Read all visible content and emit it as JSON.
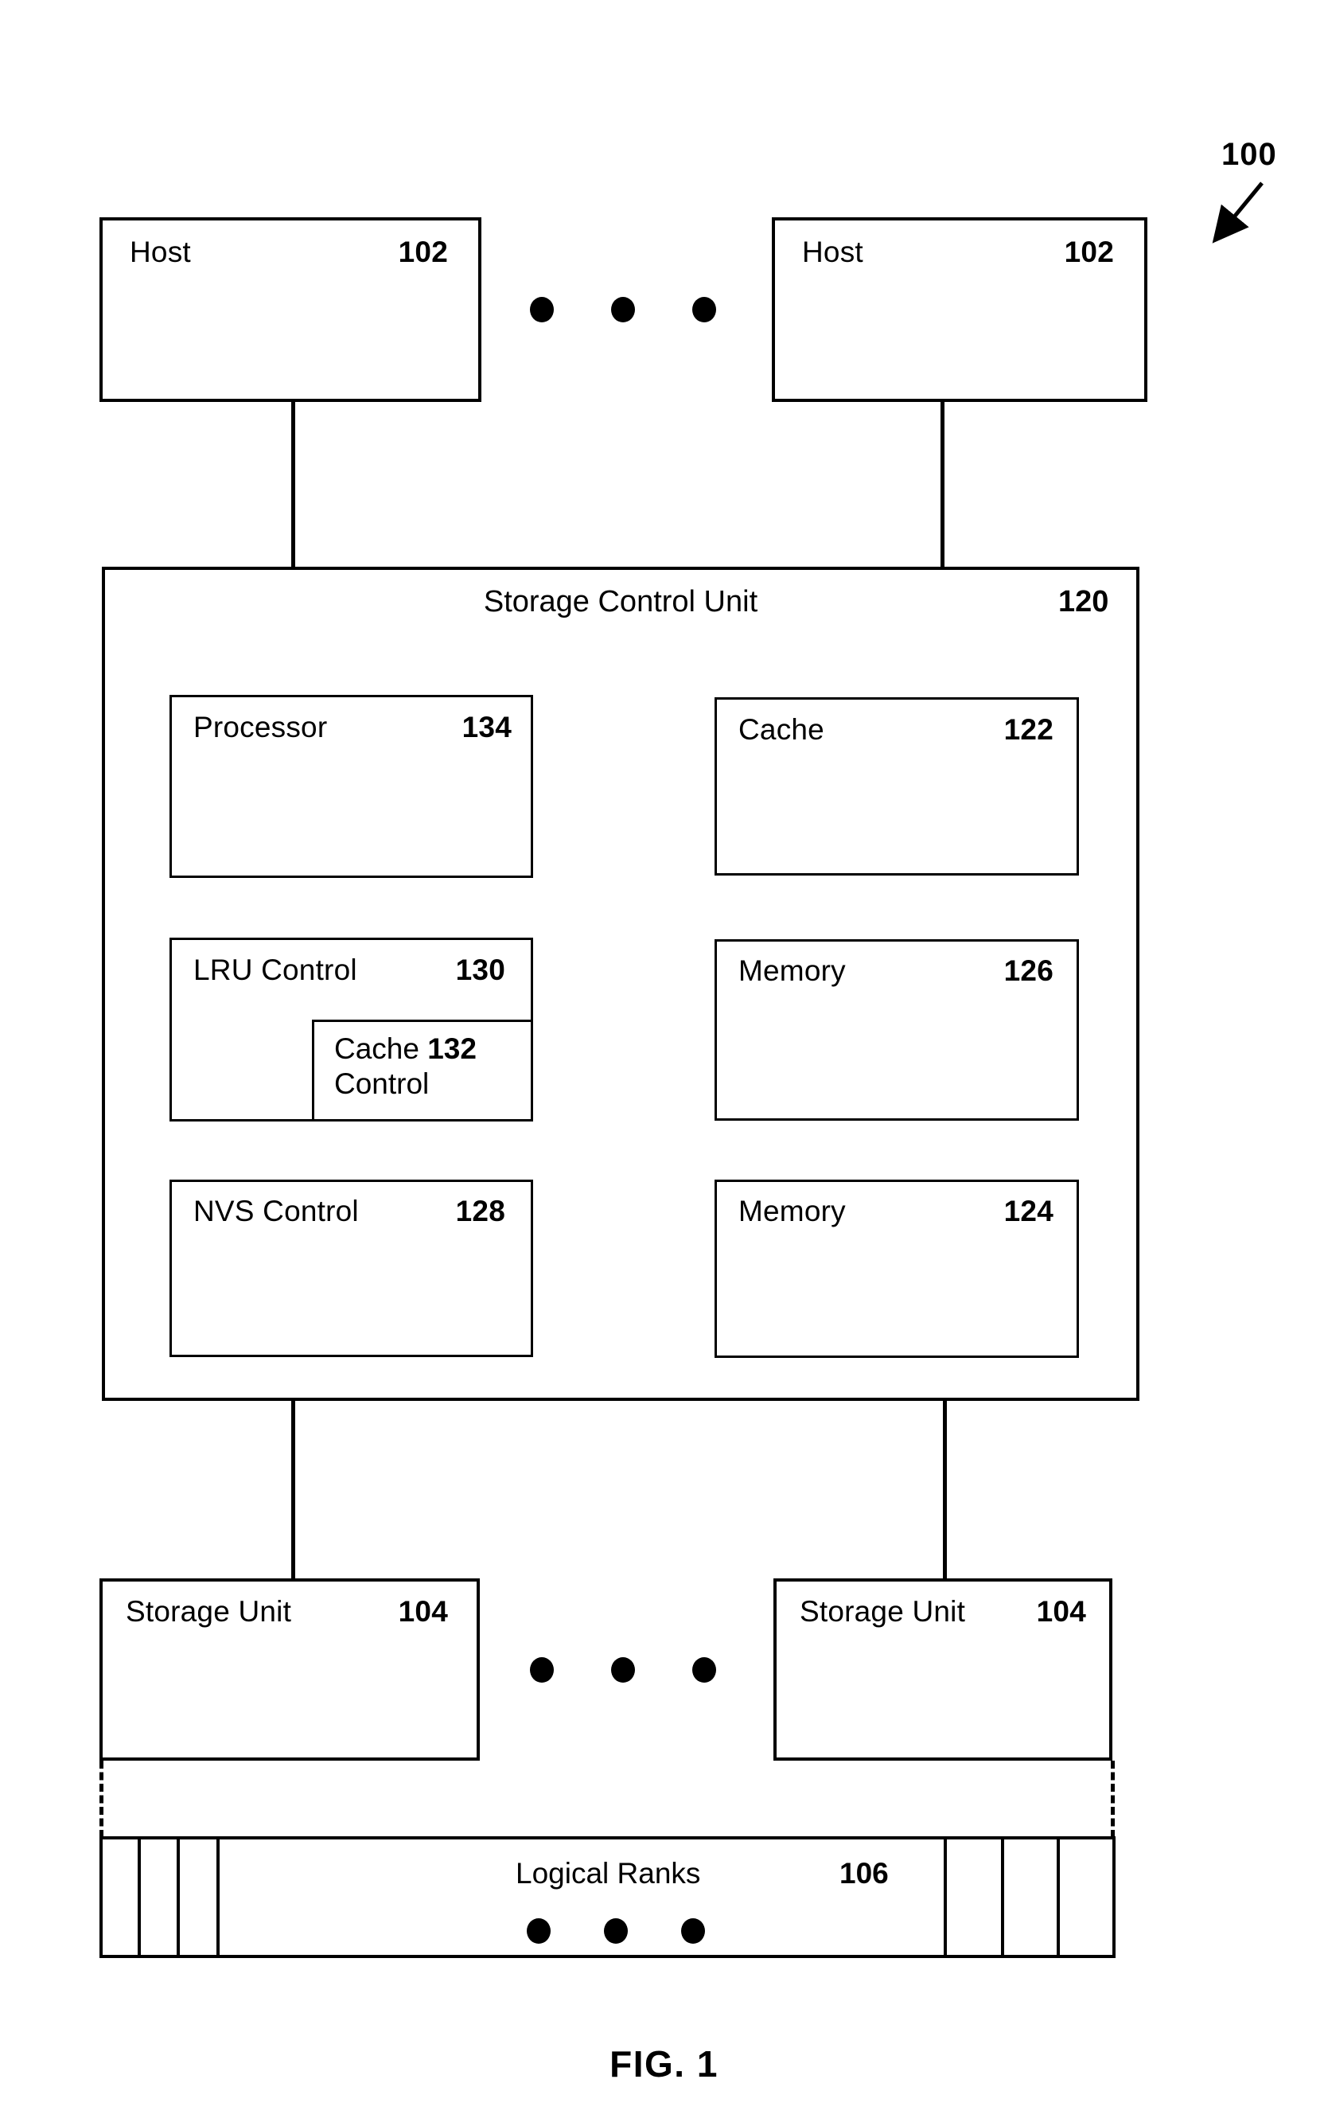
{
  "figure": {
    "caption": "FIG. 1",
    "system_reference": "100"
  },
  "hosts": [
    {
      "label": "Host",
      "ref": "102"
    },
    {
      "label": "Host",
      "ref": "102"
    }
  ],
  "storage_control_unit": {
    "title": "Storage Control Unit",
    "ref": "120",
    "components": [
      {
        "label": "Processor",
        "ref": "134"
      },
      {
        "label": "Cache",
        "ref": "122"
      },
      {
        "label": "LRU Control",
        "ref": "130"
      },
      {
        "label": "Memory",
        "ref": "126"
      },
      {
        "label": "NVS Control",
        "ref": "128"
      },
      {
        "label": "Memory",
        "ref": "124"
      }
    ],
    "nested": {
      "label_line1": "Cache",
      "label_line2": "Control",
      "ref": "132"
    }
  },
  "storage_units": [
    {
      "label": "Storage Unit",
      "ref": "104"
    },
    {
      "label": "Storage Unit",
      "ref": "104"
    }
  ],
  "logical_ranks": {
    "label": "Logical Ranks",
    "ref": "106"
  },
  "ellipsis": {
    "glyph": "•",
    "count": 3
  }
}
